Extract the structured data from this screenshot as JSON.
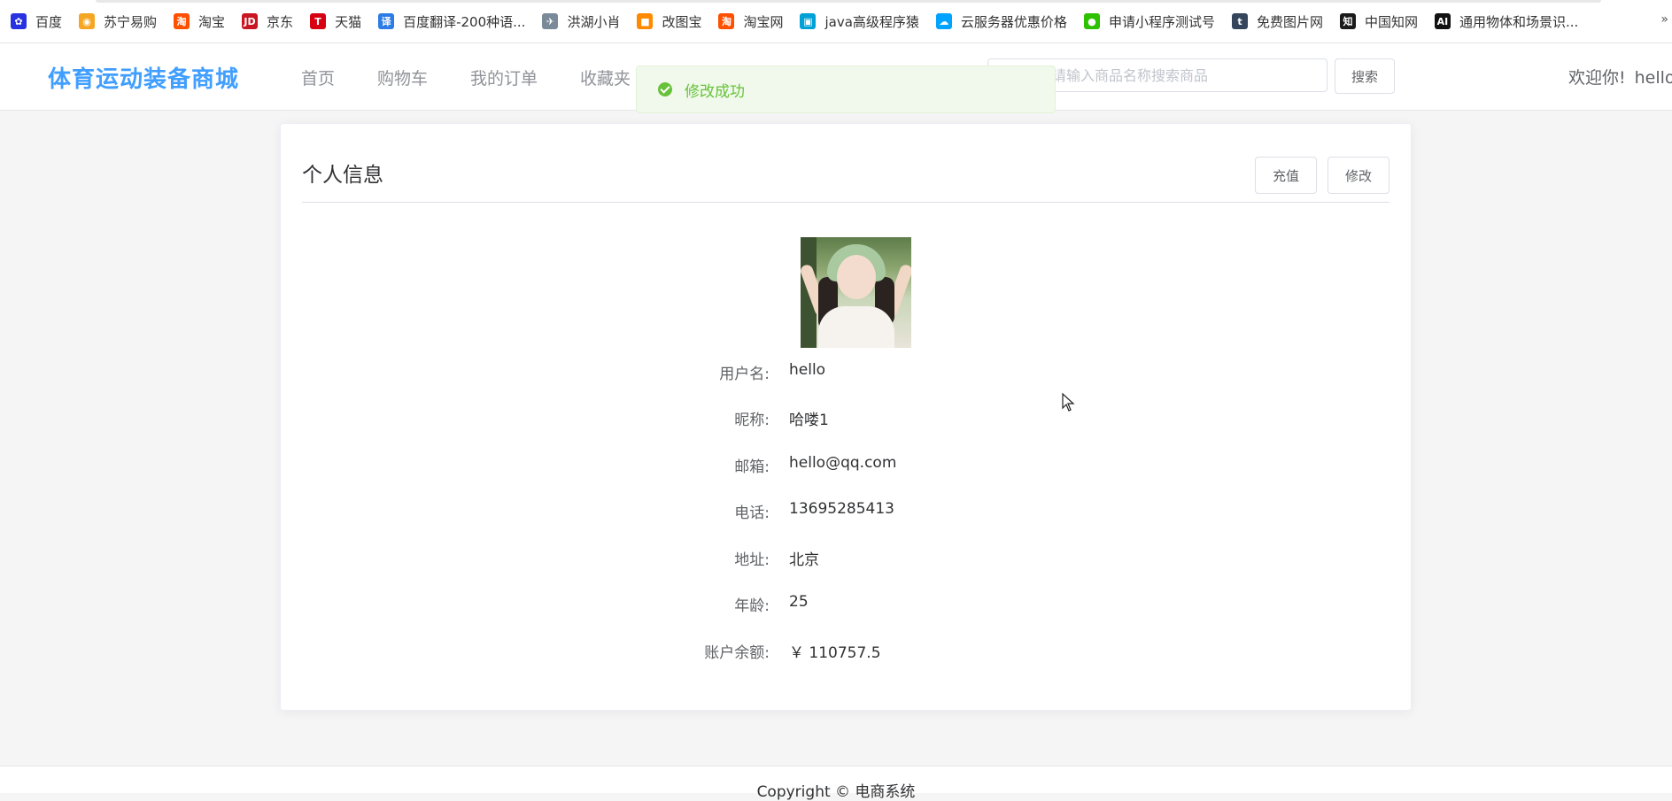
{
  "bookmarks": [
    {
      "label": "百度",
      "icon": "baidu-paw-icon",
      "color": "#2932e1",
      "glyph": "✿"
    },
    {
      "label": "苏宁易购",
      "icon": "suning-lion-icon",
      "color": "#f5a623",
      "glyph": "◉"
    },
    {
      "label": "淘宝",
      "icon": "taobao-icon",
      "color": "#ff5000",
      "glyph": "淘"
    },
    {
      "label": "京东",
      "icon": "jd-icon",
      "color": "#c91623",
      "glyph": "JD"
    },
    {
      "label": "天猫",
      "icon": "tmall-icon",
      "color": "#d70012",
      "glyph": "T"
    },
    {
      "label": "百度翻译-200种语...",
      "icon": "translate-icon",
      "color": "#2d7be5",
      "glyph": "译"
    },
    {
      "label": "洪湖小肖",
      "icon": "bird-icon",
      "color": "#7a8a99",
      "glyph": "✈"
    },
    {
      "label": "改图宝",
      "icon": "gaitubao-icon",
      "color": "#ff8a00",
      "glyph": "■"
    },
    {
      "label": "淘宝网",
      "icon": "taobao-icon",
      "color": "#ff5000",
      "glyph": "淘"
    },
    {
      "label": "java高级程序猿",
      "icon": "bilibili-icon",
      "color": "#00a1d6",
      "glyph": "▣"
    },
    {
      "label": "云服务器优惠价格",
      "icon": "cloud-icon",
      "color": "#00a3ff",
      "glyph": "☁"
    },
    {
      "label": "申请小程序测试号",
      "icon": "wechat-icon",
      "color": "#2dc100",
      "glyph": "●"
    },
    {
      "label": "免费图片网",
      "icon": "tumblr-icon",
      "color": "#35465c",
      "glyph": "t"
    },
    {
      "label": "中国知网",
      "icon": "cnki-icon",
      "color": "#1a1a1a",
      "glyph": "知"
    },
    {
      "label": "通用物体和场景识...",
      "icon": "ai-icon",
      "color": "#111111",
      "glyph": "AI"
    }
  ],
  "bookmarks_overflow": "»",
  "header": {
    "logo": "体育运动装备商城",
    "nav": [
      "首页",
      "购物车",
      "我的订单",
      "收藏夹"
    ],
    "search_placeholder": "请输入商品名称搜索商品",
    "search_button": "搜索",
    "welcome": "欢迎你!",
    "username": "hello"
  },
  "toast": {
    "message": "修改成功",
    "color": "#67c23a"
  },
  "profile": {
    "title": "个人信息",
    "recharge_button": "充值",
    "edit_button": "修改",
    "fields": [
      {
        "label": "用户名:",
        "value": "hello"
      },
      {
        "label": "昵称:",
        "value": "哈喽1"
      },
      {
        "label": "邮箱:",
        "value": "hello@qq.com"
      },
      {
        "label": "电话:",
        "value": "13695285413"
      },
      {
        "label": "地址:",
        "value": "北京"
      },
      {
        "label": "年龄:",
        "value": "25"
      },
      {
        "label": "账户余额:",
        "value": "￥ 110757.5"
      }
    ]
  },
  "footer": {
    "copyright": "Copyright © 电商系统"
  },
  "colors": {
    "brand": "#409eff",
    "success": "#67c23a"
  }
}
